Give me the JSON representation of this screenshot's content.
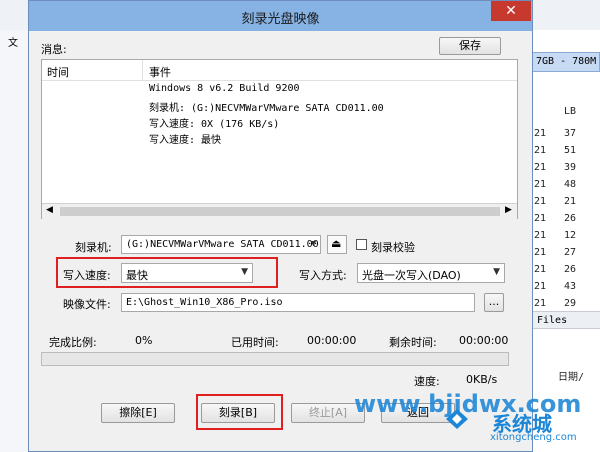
{
  "background_app": {
    "size_header": "7GB - 780M",
    "column_header": "LB",
    "left_tab": "文",
    "right_rows_a": [
      "21",
      "21",
      "21",
      "21",
      "21",
      "21",
      "21",
      "21",
      "21",
      "21",
      "21",
      "21",
      "21"
    ],
    "right_rows_b": [
      "37",
      "51",
      "39",
      "48",
      "21",
      "26",
      "12",
      "27",
      "26",
      "43",
      "29",
      "16"
    ],
    "files_label": "Files",
    "date_header": "日期/"
  },
  "dialog": {
    "title": "刻录光盘映像",
    "close_glyph": "✕",
    "messages_label": "消息:",
    "save_button": "保存",
    "log": {
      "col_time": "时间",
      "col_event": "事件",
      "lines": [
        "Windows 8 v6.2 Build 9200",
        "刻录机: (G:)NECVMWarVMware SATA CD011.00",
        "写入速度: 0X (176 KB/s)",
        "写入速度: 最快"
      ]
    },
    "burner_label": "刻录机:",
    "burner_value": "(G:)NECVMWarVMware SATA CD011.00",
    "verify_label": "刻录校验",
    "verify_checked": false,
    "write_speed_label": "写入速度:",
    "write_speed_value": "最快",
    "write_method_label": "写入方式:",
    "write_method_value": "光盘一次写入(DAO)",
    "image_file_label": "映像文件:",
    "image_file_value": "E:\\Ghost_Win10_X86_Pro.iso",
    "browse_button": "...",
    "progress": {
      "complete_label": "完成比例:",
      "complete_value": "0%",
      "elapsed_label": "已用时间:",
      "elapsed_value": "00:00:00",
      "remaining_label": "剩余时间:",
      "remaining_value": "00:00:00",
      "fraction": 0
    },
    "speed_label": "速度:",
    "speed_value": "0KB/s",
    "buttons": {
      "erase": "擦除[E]",
      "burn": "刻录[B]",
      "stop": "终止[A]",
      "back": "返回"
    }
  },
  "watermark": {
    "url": "www.bjjdwx.com",
    "brand": "系统城",
    "site": "xitongcheng.com"
  },
  "colors": {
    "titlebar": "#87b2e4",
    "close": "#c7382f",
    "highlight": "#e02020",
    "watermark_blue": "#1d86d6"
  }
}
